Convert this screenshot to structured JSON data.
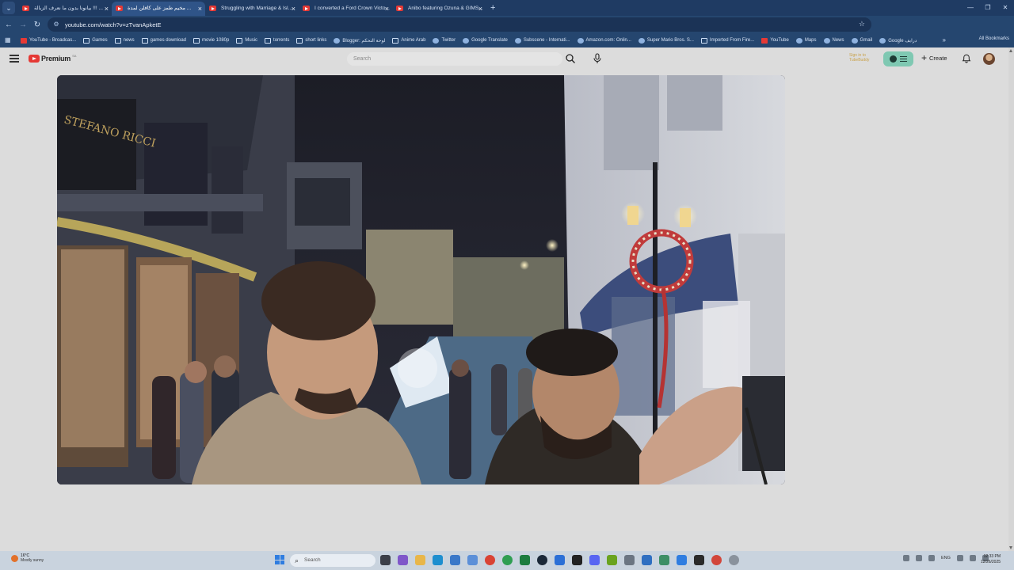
{
  "browser": {
    "tab_search_icon": "chevron-down-icon",
    "tabs": [
      {
        "title": "بيانونا بدون ما نعرف الزبالة !!! ...",
        "active": false
      },
      {
        "title": "مخيم طمز على كافلن لمدة ...",
        "active": true
      },
      {
        "title": "Struggling with Marriage & Isl...",
        "active": false
      },
      {
        "title": "I converted a Ford Crown Victo...",
        "active": false
      },
      {
        "title": "Anibo featuring Ozuna & GIMS...",
        "active": false
      }
    ],
    "new_tab_label": "+",
    "window_controls": [
      "—",
      "❐",
      "✕"
    ],
    "url": "youtube.com/watch?v=zTvanApketE",
    "bookmarks": [
      {
        "label": "YouTube - Broadcas...",
        "icon": "yt"
      },
      {
        "label": "Games",
        "icon": "folder"
      },
      {
        "label": "news",
        "icon": "folder"
      },
      {
        "label": "games download",
        "icon": "folder"
      },
      {
        "label": "movie 1080p",
        "icon": "folder"
      },
      {
        "label": "Music",
        "icon": "folder"
      },
      {
        "label": "torrents",
        "icon": "folder"
      },
      {
        "label": "short links",
        "icon": "folder"
      },
      {
        "label": "Blogger: لوحة التحكم",
        "icon": "gen"
      },
      {
        "label": "Anime Arab",
        "icon": "folder"
      },
      {
        "label": "Twitter",
        "icon": "gen"
      },
      {
        "label": "Google Translate",
        "icon": "gen"
      },
      {
        "label": "Subscene - Internati...",
        "icon": "gen"
      },
      {
        "label": "Amazon.com: Onlin...",
        "icon": "gen"
      },
      {
        "label": "Super Mario Bros. S...",
        "icon": "gen"
      },
      {
        "label": "Imported From Fire...",
        "icon": "folder"
      },
      {
        "label": "YouTube",
        "icon": "yt"
      },
      {
        "label": "Maps",
        "icon": "gen"
      },
      {
        "label": "News",
        "icon": "gen"
      },
      {
        "label": "Gmail",
        "icon": "gen"
      },
      {
        "label": "Google درايف",
        "icon": "gen"
      }
    ],
    "bookmarks_more": "»",
    "all_bookmarks": "All Bookmarks"
  },
  "youtube": {
    "logo_text": "Premium",
    "logo_sup": "SA",
    "search_placeholder": "Search",
    "tubebuddy_line1": "Sign in to",
    "tubebuddy_line2": "TubeBuddy",
    "create_label": "Create"
  },
  "taskbar": {
    "weather_temp": "16°C",
    "weather_desc": "Mostly sunny",
    "search_placeholder": "Search",
    "language": "ENG",
    "time": "12:33 PM",
    "date": "12/26/2025"
  }
}
